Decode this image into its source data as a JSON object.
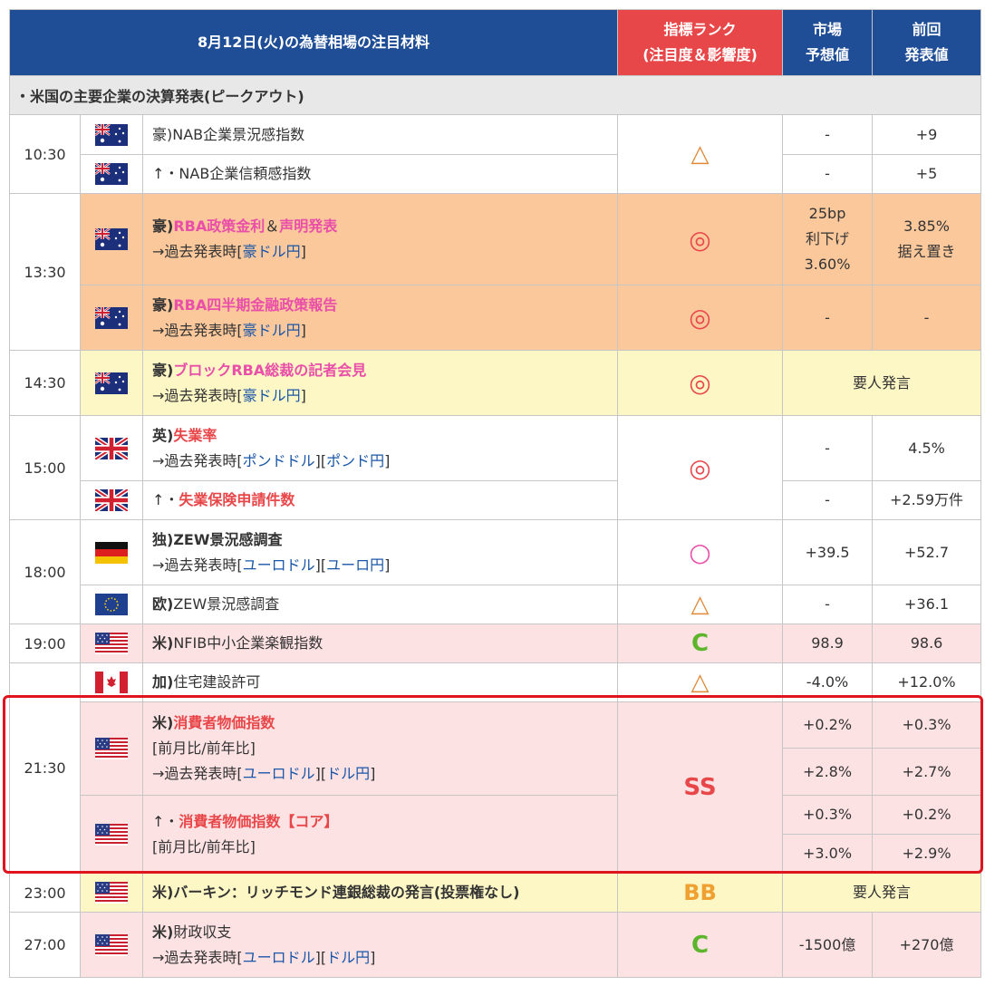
{
  "header": {
    "title": "8月12日(火)の為替相場の注目材料",
    "rank_line1": "指標ランク",
    "rank_line2": "(注目度＆影響度)",
    "forecast_line1": "市場",
    "forecast_line2": "予想値",
    "previous_line1": "前回",
    "previous_line2": "発表値"
  },
  "section_note": "・米国の主要企業の決算発表(ピークアウト)",
  "colors": {
    "header_bg": "#1f4e97",
    "rank_header_bg": "#e8474a",
    "orange_row": "#fbc89c",
    "yellow_row": "#fdf7c6",
    "pink_row": "#fde2e4",
    "highlight_border": "#e0141e"
  },
  "rows": {
    "r1030": {
      "time": "10:30",
      "e1": {
        "country": "豪)",
        "name": "NAB企業景況感指数",
        "forecast": "-",
        "previous": "+9"
      },
      "e2": {
        "prefix": "↑・",
        "name": "NAB企業信頼感指数",
        "forecast": "-",
        "previous": "+5"
      },
      "rank": "△"
    },
    "r1330": {
      "time": "13:30",
      "e1": {
        "country": "豪)",
        "name_a": "RBA政策金利",
        "amp": "＆",
        "name_b": "声明発表",
        "past": "→過去発表時[",
        "link1": "豪ドル円",
        "close": "]",
        "rank": "◎",
        "forecast_l1": "25bp",
        "forecast_l2": "利下げ",
        "forecast_l3": "3.60%",
        "previous_l1": "3.85%",
        "previous_l2": "据え置き"
      },
      "e2": {
        "country": "豪)",
        "name": "RBA四半期金融政策報告",
        "past": "→過去発表時[",
        "link1": "豪ドル円",
        "close": "]",
        "rank": "◎",
        "forecast": "-",
        "previous": "-"
      }
    },
    "r1430": {
      "time": "14:30",
      "country": "豪)",
      "name": "ブロックRBA総裁の記者会見",
      "past": "→過去発表時[",
      "link1": "豪ドル円",
      "close": "]",
      "rank": "◎",
      "note": "要人発言"
    },
    "r1500": {
      "time": "15:00",
      "e1": {
        "country": "英)",
        "name": "失業率",
        "past": "→過去発表時[",
        "link1": "ポンドドル",
        "mid": "][",
        "link2": "ポンド円",
        "close": "]",
        "forecast": "-",
        "previous": "4.5%"
      },
      "e2": {
        "prefix": "↑・",
        "name": "失業保険申請件数",
        "forecast": "-",
        "previous": "+2.59万件"
      },
      "rank": "◎"
    },
    "r1800": {
      "time": "18:00",
      "e1": {
        "country": "独)",
        "name": "ZEW景況感調査",
        "past": "→過去発表時[",
        "link1": "ユーロドル",
        "mid": "][",
        "link2": "ユーロ円",
        "close": "]",
        "rank": "○",
        "forecast": "+39.5",
        "previous": "+52.7"
      },
      "e2": {
        "country": "欧)",
        "name": "ZEW景況感調査",
        "rank": "△",
        "forecast": "-",
        "previous": "+36.1"
      }
    },
    "r1900": {
      "time": "19:00",
      "country": "米)",
      "name": "NFIB中小企業楽観指数",
      "rank": "C",
      "forecast": "98.9",
      "previous": "98.6"
    },
    "r2130": {
      "time": "21:30",
      "e0": {
        "country": "加)",
        "name": "住宅建設許可",
        "rank": "△",
        "forecast": "-4.0%",
        "previous": "+12.0%"
      },
      "e1": {
        "country": "米)",
        "name": "消費者物価指数",
        "sub": "[前月比/前年比]",
        "past": "→過去発表時[",
        "link1": "ユーロドル",
        "mid": "][",
        "link2": "ドル円",
        "close": "]",
        "forecast_a": "+0.2%",
        "previous_a": "+0.3%",
        "forecast_b": "+2.8%",
        "previous_b": "+2.7%"
      },
      "e2": {
        "prefix": "↑・",
        "name": "消費者物価指数【コア】",
        "sub": "[前月比/前年比]",
        "forecast_a": "+0.3%",
        "previous_a": "+0.2%",
        "forecast_b": "+3.0%",
        "previous_b": "+2.9%"
      },
      "rank": "SS"
    },
    "r2300": {
      "time": "23:00",
      "country": "米)",
      "name": "バーキン：リッチモンド連銀総裁の発言(投票権なし)",
      "rank": "BB",
      "note": "要人発言"
    },
    "r2700": {
      "time": "27:00",
      "country": "米)",
      "name": "財政収支",
      "past": "→過去発表時[",
      "link1": "ユーロドル",
      "mid": "][",
      "link2": "ドル円",
      "close": "]",
      "rank": "C",
      "forecast": "-1500億",
      "previous": "+270億"
    }
  }
}
